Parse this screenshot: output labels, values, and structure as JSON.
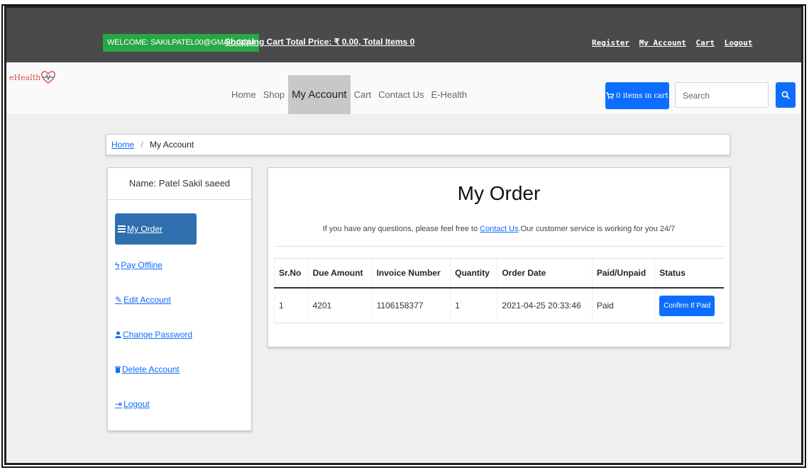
{
  "topbar": {
    "welcome": "WELCOME: SAKILPATEL00@GMAIL.COM",
    "cart_total": "Shopping Cart Total Price: ₹ 0.00, Total Items 0",
    "links": [
      "Register",
      "My Account",
      "Cart",
      "Logout"
    ]
  },
  "navbar": {
    "logo_text": "eHealth",
    "links": [
      "Home",
      "Shop",
      "My Account",
      "Cart",
      "Contact Us",
      "E-Health"
    ],
    "active": "My Account",
    "cart_button": "0 items in cart",
    "search_placeholder": "Search"
  },
  "breadcrumb": {
    "home": "Home",
    "current": "My Account"
  },
  "sidebar": {
    "name": "Name: Patel Sakil saeed",
    "items": [
      "My Order",
      "Pay Offline",
      "Edit Account",
      "Change Password",
      "Delete Account",
      "Logout"
    ]
  },
  "orders": {
    "title": "My Order",
    "subtitle_pre": "If you have any questions, please feel free to",
    "contact_link": "Contact Us",
    "subtitle_post": "Our customer service is working for you 24/7",
    "columns": [
      "Sr.No",
      "Due Amount",
      "Invoice Number",
      "Quantity",
      "Order Date",
      "Paid/Unpaid",
      "Status"
    ],
    "rows": [
      {
        "sr": "1",
        "due": "4201",
        "invoice": "1106158377",
        "qty": "1",
        "date": "2021-04-25 20:33:46",
        "paid": "Paid",
        "action": "Confirm If Paid"
      }
    ]
  },
  "colors": {
    "topbar": "#4a4a4a",
    "welcome_bg": "#28a745",
    "primary": "#0d6efd",
    "active_side": "#2f6fad"
  }
}
